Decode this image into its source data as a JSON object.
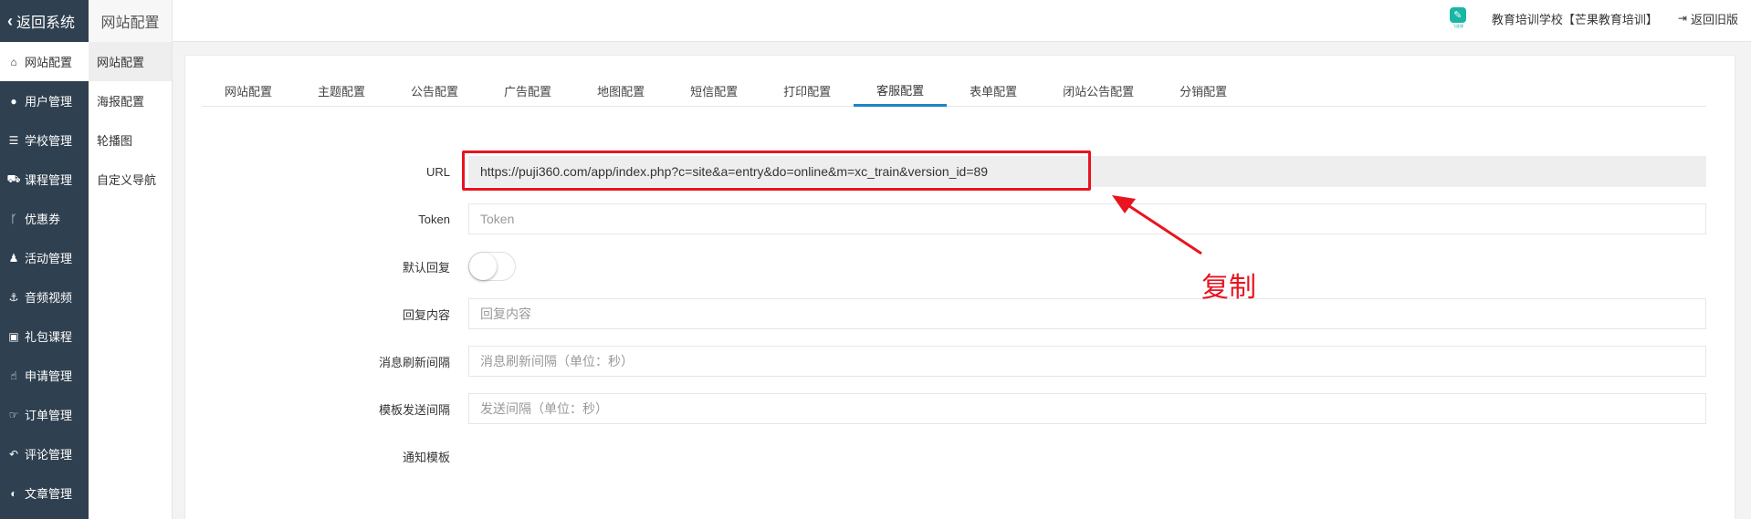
{
  "topbar": {
    "back_label": "返回系统",
    "page_title": "网站配置",
    "logo_text": "飞速课",
    "school_name": "教育培训学校【芒果教育培训】",
    "old_version_label": "返回旧版"
  },
  "leftnav": [
    {
      "label": "网站配置",
      "icon": "home-icon"
    },
    {
      "label": "用户管理",
      "icon": "user-icon"
    },
    {
      "label": "学校管理",
      "icon": "server-icon"
    },
    {
      "label": "课程管理",
      "icon": "cart-icon"
    },
    {
      "label": "优惠券",
      "icon": "branch-icon"
    },
    {
      "label": "活动管理",
      "icon": "users-icon"
    },
    {
      "label": "音频视频",
      "icon": "anchor-icon"
    },
    {
      "label": "礼包课程",
      "icon": "gift-icon"
    },
    {
      "label": "申请管理",
      "icon": "hand-icon"
    },
    {
      "label": "订单管理",
      "icon": "thumbs-icon"
    },
    {
      "label": "评论管理",
      "icon": "reply-icon"
    },
    {
      "label": "文章管理",
      "icon": "half-circle-icon"
    }
  ],
  "subnav": [
    {
      "label": "网站配置"
    },
    {
      "label": "海报配置"
    },
    {
      "label": "轮播图"
    },
    {
      "label": "自定义导航"
    }
  ],
  "tabs": [
    {
      "label": "网站配置"
    },
    {
      "label": "主题配置"
    },
    {
      "label": "公告配置"
    },
    {
      "label": "广告配置"
    },
    {
      "label": "地图配置"
    },
    {
      "label": "短信配置"
    },
    {
      "label": "打印配置"
    },
    {
      "label": "客服配置"
    },
    {
      "label": "表单配置"
    },
    {
      "label": "闭站公告配置"
    },
    {
      "label": "分销配置"
    }
  ],
  "active_tab": "客服配置",
  "form": {
    "url_label": "URL",
    "url_value": "https://puji360.com/app/index.php?c=site&a=entry&do=online&m=xc_train&version_id=89",
    "token_label": "Token",
    "token_placeholder": "Token",
    "default_reply_label": "默认回复",
    "default_reply_on": false,
    "reply_content_label": "回复内容",
    "reply_content_placeholder": "回复内容",
    "refresh_label": "消息刷新间隔",
    "refresh_placeholder": "消息刷新间隔（单位：秒）",
    "template_label": "模板发送间隔",
    "template_placeholder": "发送间隔（单位：秒）",
    "notify_label": "通知模板"
  },
  "annotation": {
    "text": "复制",
    "color": "#e8141f"
  },
  "colors": {
    "sidebar_bg": "#2f4050",
    "active_tab_underline": "#1c84c6"
  }
}
